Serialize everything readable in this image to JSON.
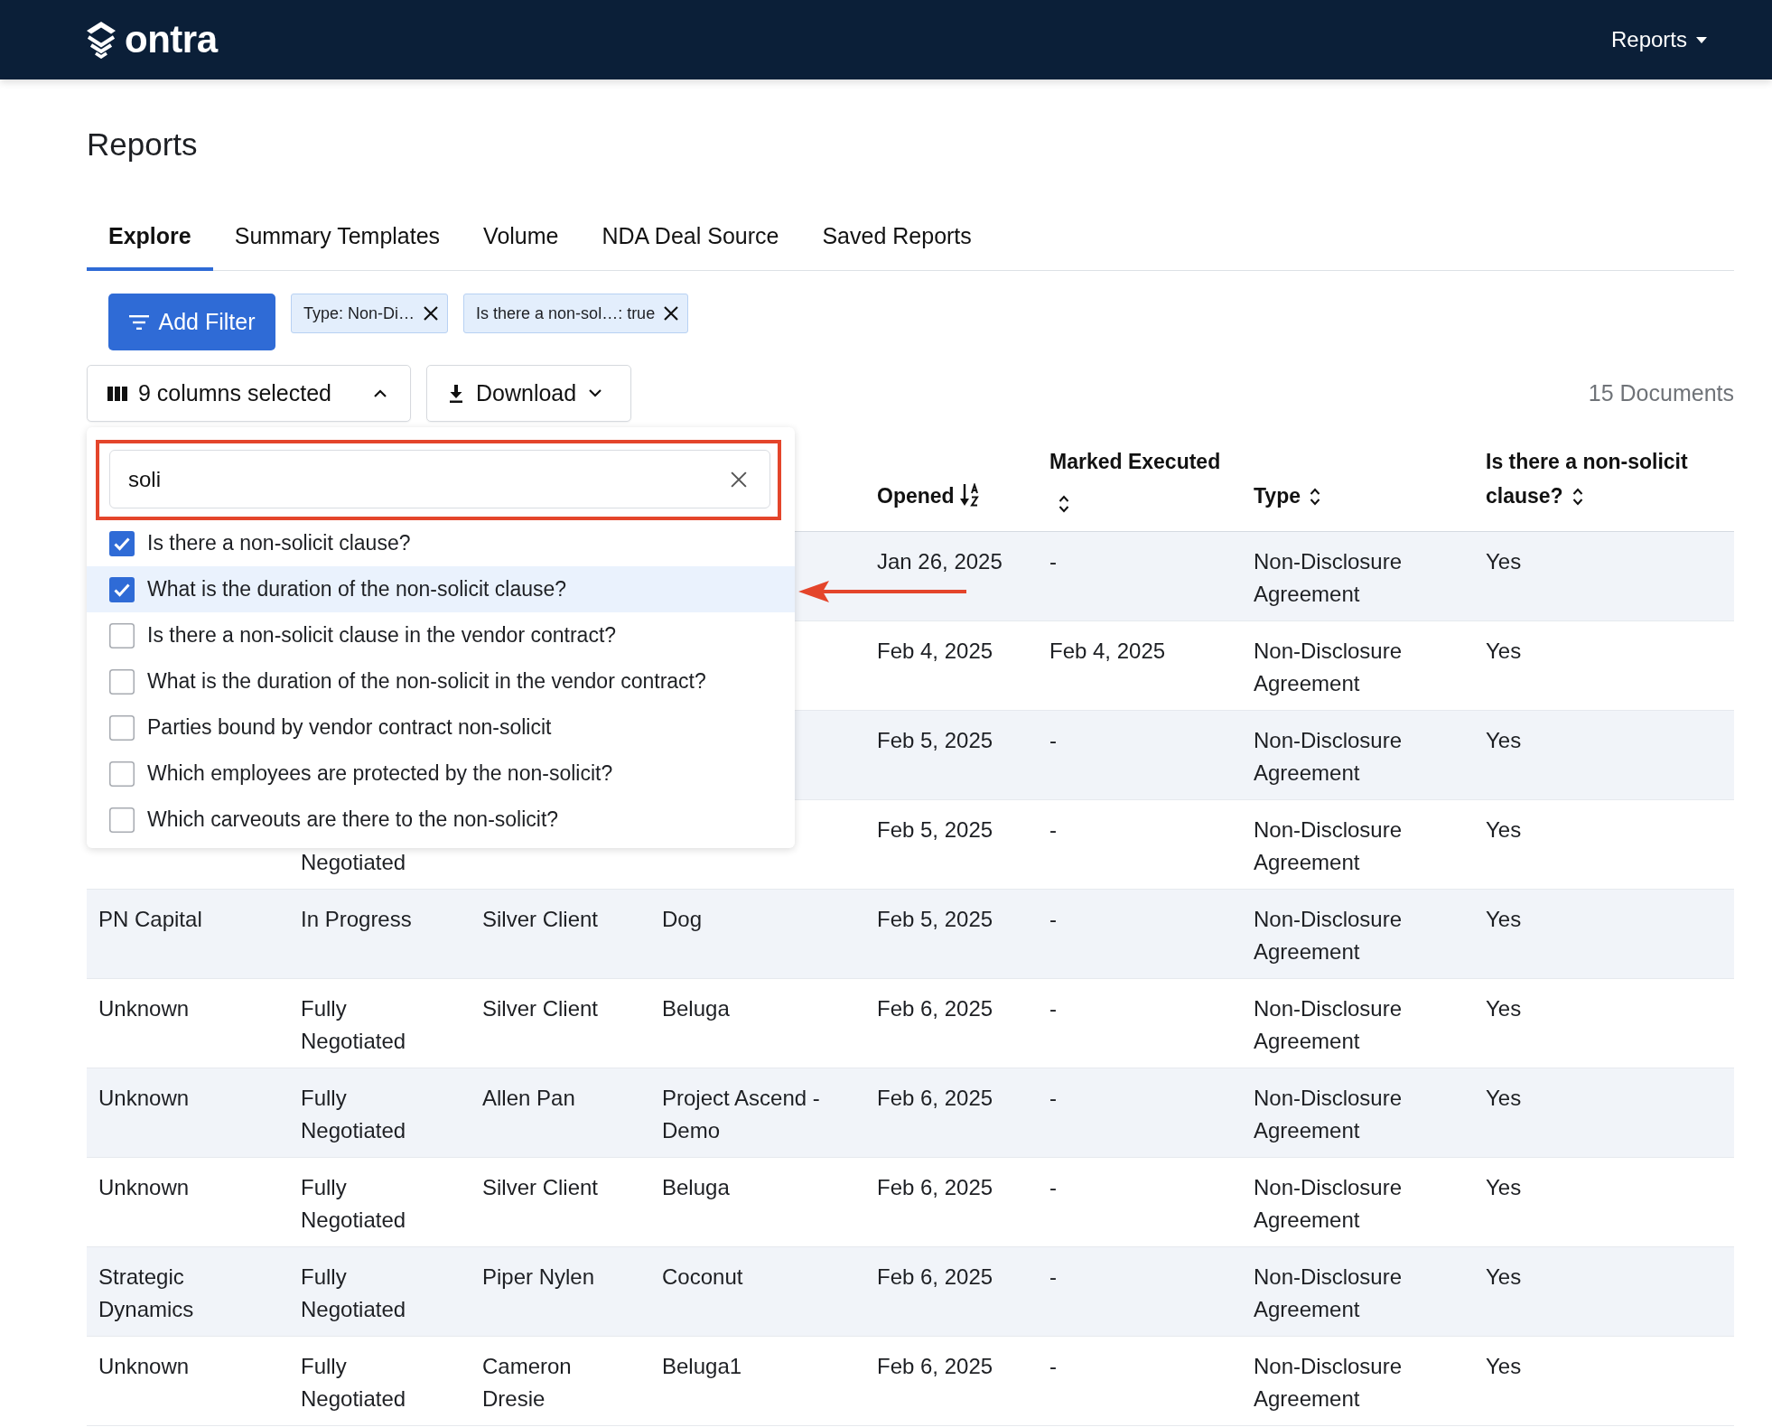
{
  "header": {
    "brand": "ontra",
    "nav_menu": {
      "label": "Reports"
    }
  },
  "page": {
    "title": "Reports"
  },
  "tabs": [
    {
      "label": "Explore",
      "selected": true
    },
    {
      "label": "Summary Templates",
      "selected": false
    },
    {
      "label": "Volume",
      "selected": false
    },
    {
      "label": "NDA Deal Source",
      "selected": false
    },
    {
      "label": "Saved Reports",
      "selected": false
    }
  ],
  "filters": {
    "add_button": "Add Filter",
    "chips": [
      {
        "label": "Type: Non-Di…"
      },
      {
        "label": "Is there a non-sol…: true"
      }
    ]
  },
  "toolbar": {
    "columns_button": {
      "label": "9 columns selected",
      "expanded": true
    },
    "download_button": {
      "label": "Download",
      "expanded": false
    },
    "document_count": "15 Documents"
  },
  "columns_menu": {
    "search": {
      "value": "soli"
    },
    "options": [
      {
        "label": "Is there a non-solicit clause?",
        "checked": true,
        "highlighted": false
      },
      {
        "label": "What is the duration of the non-solicit clause?",
        "checked": true,
        "highlighted": true
      },
      {
        "label": "Is there a non-solicit clause in the vendor contract?",
        "checked": false,
        "highlighted": false
      },
      {
        "label": "What is the duration of the non-solicit in the vendor contract?",
        "checked": false,
        "highlighted": false
      },
      {
        "label": "Parties bound by vendor contract non-solicit",
        "checked": false,
        "highlighted": false
      },
      {
        "label": "Which employees are protected by the non-solicit?",
        "checked": false,
        "highlighted": false
      },
      {
        "label": "Which carveouts are there to the non-solicit?",
        "checked": false,
        "highlighted": false
      }
    ]
  },
  "table": {
    "columns": [
      "",
      "",
      "",
      "",
      {
        "label": "Opened",
        "sorted": true
      },
      {
        "label": "Marked Executed",
        "sorted": false
      },
      {
        "label": "Type",
        "sorted": false
      },
      {
        "label": "Is there a non-solicit clause?",
        "sorted": false
      }
    ],
    "rows": [
      [
        "",
        "",
        "",
        "",
        "Jan 26, 2025",
        "-",
        "Non-Disclosure Agreement",
        "Yes"
      ],
      [
        "",
        "",
        "",
        "",
        "Feb 4, 2025",
        "Feb 4, 2025",
        "Non-Disclosure Agreement",
        "Yes"
      ],
      [
        "",
        "",
        "",
        "",
        "Feb 5, 2025",
        "-",
        "Non-Disclosure Agreement",
        "Yes"
      ],
      [
        "",
        "\nNegotiated",
        "",
        "",
        "Feb 5, 2025",
        "-",
        "Non-Disclosure Agreement",
        "Yes"
      ],
      [
        "PN Capital",
        "In Progress",
        "Silver Client",
        "Dog",
        "Feb 5, 2025",
        "-",
        "Non-Disclosure Agreement",
        "Yes"
      ],
      [
        "Unknown",
        "Fully Negotiated",
        "Silver Client",
        "Beluga",
        "Feb 6, 2025",
        "-",
        "Non-Disclosure Agreement",
        "Yes"
      ],
      [
        "Unknown",
        "Fully Negotiated",
        "Allen Pan",
        "Project Ascend - Demo",
        "Feb 6, 2025",
        "-",
        "Non-Disclosure Agreement",
        "Yes"
      ],
      [
        "Unknown",
        "Fully Negotiated",
        "Silver Client",
        "Beluga",
        "Feb 6, 2025",
        "-",
        "Non-Disclosure Agreement",
        "Yes"
      ],
      [
        "Strategic Dynamics",
        "Fully Negotiated",
        "Piper Nylen",
        "Coconut",
        "Feb 6, 2025",
        "-",
        "Non-Disclosure Agreement",
        "Yes"
      ],
      [
        "Unknown",
        "Fully Negotiated",
        "Cameron Dresie",
        "Beluga1",
        "Feb 6, 2025",
        "-",
        "Non-Disclosure Agreement",
        "Yes"
      ]
    ]
  }
}
